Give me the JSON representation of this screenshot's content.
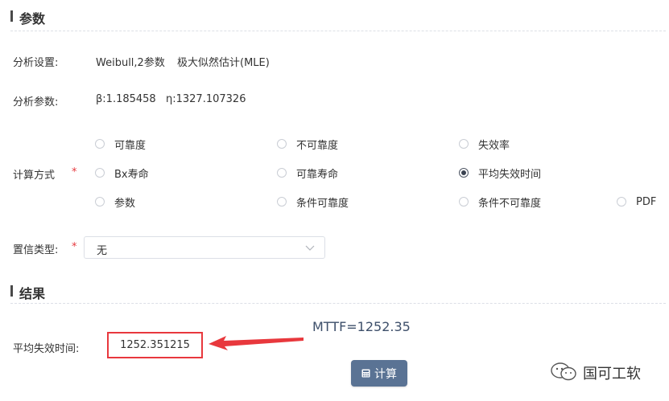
{
  "params_section": {
    "title": "参数"
  },
  "analysis_settings": {
    "label": "分析设置:",
    "distribution": "Weibull,2参数",
    "method": "极大似然估计(MLE)"
  },
  "analysis_params": {
    "label": "分析参数:",
    "beta": "β:1.185458",
    "eta": "η:1327.107326"
  },
  "calc_method": {
    "label": "计算方式",
    "required_mark": "*",
    "options": [
      {
        "label": "可靠度",
        "checked": false
      },
      {
        "label": "不可靠度",
        "checked": false
      },
      {
        "label": "失效率",
        "checked": false
      },
      {
        "label": "Bx寿命",
        "checked": false
      },
      {
        "label": "可靠寿命",
        "checked": false
      },
      {
        "label": "平均失效时间",
        "checked": true
      },
      {
        "label": "参数",
        "checked": false
      },
      {
        "label": "条件可靠度",
        "checked": false
      },
      {
        "label": "条件不可靠度",
        "checked": false
      },
      {
        "label": "PDF",
        "checked": false
      }
    ]
  },
  "confidence": {
    "label": "置信类型:",
    "required_mark": "*",
    "selected": "无"
  },
  "results_section": {
    "title": "结果"
  },
  "result": {
    "label": "平均失效时间:",
    "value": "1252.351215",
    "annotation": "MTTF=1252.35",
    "highlight_color": "#e8383d"
  },
  "calc_button": {
    "label": "计算",
    "color": "#5a7394"
  },
  "watermark": {
    "text": "国可工软",
    "icon": "wechat-icon"
  }
}
